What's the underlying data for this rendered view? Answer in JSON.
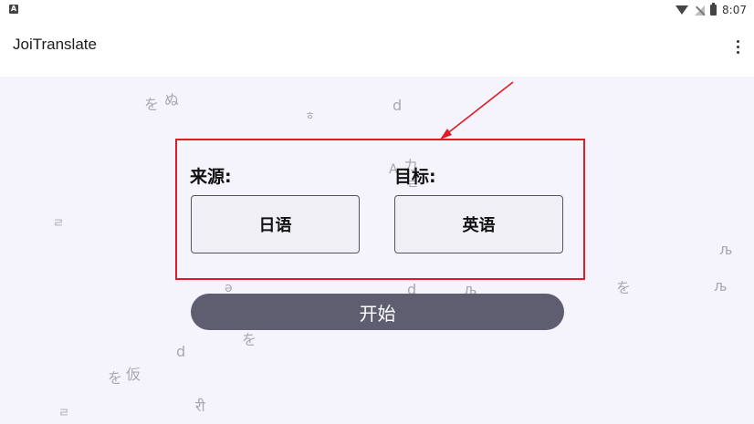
{
  "status_bar": {
    "app_icon_letter": "A",
    "time": "8:07"
  },
  "app_bar": {
    "title": "JoiTranslate"
  },
  "form": {
    "source_label": "来源:",
    "target_label": "目标:",
    "source_language": "日语",
    "target_language": "英语",
    "start_label": "开始"
  },
  "background_glyphs": [
    "を",
    "ぬ",
    "ㅎ",
    "d",
    "ㄹ",
    "カ",
    "A",
    "ㄹ",
    "љ",
    "ə",
    "d",
    "љ",
    "を",
    "љ",
    "を",
    "d",
    "を",
    "仮",
    "ㄹ",
    "री"
  ],
  "colors": {
    "highlight": "#e01b24",
    "start_button": "#5e5e70",
    "content_background": "#f5f3fc"
  }
}
